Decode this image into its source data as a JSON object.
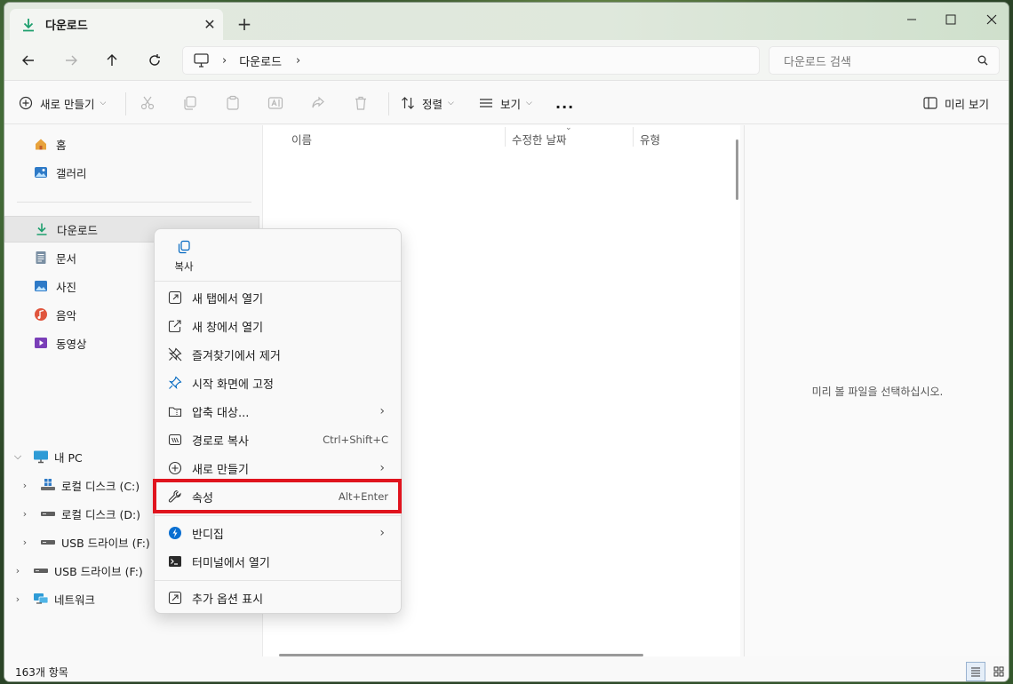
{
  "tab": {
    "title": "다운로드",
    "close_icon": "close-icon",
    "new_tab": "+"
  },
  "address": {
    "crumbs": [
      "다운로드"
    ]
  },
  "search": {
    "placeholder": "다운로드 검색"
  },
  "toolbar": {
    "new_label": "새로 만들기",
    "sort_label": "정렬",
    "view_label": "보기",
    "more_label": "...",
    "preview_label": "미리 보기"
  },
  "sidebar": {
    "top_items": [
      {
        "label": "홈",
        "icon": "home-icon"
      },
      {
        "label": "갤러리",
        "icon": "gallery-icon"
      }
    ],
    "quick_items": [
      {
        "label": "다운로드",
        "icon": "download-icon"
      },
      {
        "label": "문서",
        "icon": "document-icon"
      },
      {
        "label": "사진",
        "icon": "pictures-icon"
      },
      {
        "label": "음악",
        "icon": "music-icon"
      },
      {
        "label": "동영상",
        "icon": "video-icon"
      }
    ],
    "pc_items": [
      {
        "label": "내 PC",
        "icon": "pc-icon"
      },
      {
        "label": "로컬 디스크 (C:)",
        "icon": "windows-drive-icon"
      },
      {
        "label": "로컬 디스크 (D:)",
        "icon": "drive-icon"
      },
      {
        "label": "USB 드라이브 (F:)",
        "icon": "usb-drive-icon"
      },
      {
        "label": "USB 드라이브 (F:)",
        "icon": "usb-drive-icon"
      },
      {
        "label": "네트워크",
        "icon": "network-icon"
      }
    ]
  },
  "columns": [
    "이름",
    "수정한 날짜",
    "유형"
  ],
  "preview_message": "미리 볼 파일을 선택하십시오.",
  "status": {
    "count": "163개 항목"
  },
  "context_menu": {
    "copy_label": "복사",
    "items": [
      {
        "label": "새 탭에서 열기",
        "icon": "open-new-tab-icon",
        "shortcut": "",
        "arrow": ""
      },
      {
        "label": "새 창에서 열기",
        "icon": "open-new-window-icon",
        "shortcut": "",
        "arrow": ""
      },
      {
        "label": "즐겨찾기에서 제거",
        "icon": "unpin-icon",
        "shortcut": "",
        "arrow": ""
      },
      {
        "label": "시작 화면에 고정",
        "icon": "pin-icon",
        "shortcut": "",
        "arrow": ""
      },
      {
        "label": "압축 대상...",
        "icon": "zip-icon",
        "shortcut": "",
        "arrow": "›"
      },
      {
        "label": "경로로 복사",
        "icon": "copy-path-icon",
        "shortcut": "Ctrl+Shift+C",
        "arrow": ""
      },
      {
        "label": "새로 만들기",
        "icon": "new-icon",
        "shortcut": "",
        "arrow": "›"
      },
      {
        "label": "속성",
        "icon": "wrench-icon",
        "shortcut": "Alt+Enter",
        "arrow": ""
      },
      {
        "label": "반디집",
        "icon": "bandizip-icon",
        "shortcut": "",
        "arrow": "›"
      },
      {
        "label": "터미널에서 열기",
        "icon": "terminal-icon",
        "shortcut": "",
        "arrow": ""
      },
      {
        "label": "추가 옵션 표시",
        "icon": "more-options-icon",
        "shortcut": "",
        "arrow": ""
      }
    ]
  },
  "colors": {
    "highlight": "#e0141e",
    "accent": "#0067c0",
    "download_green": "#1e9f6e"
  }
}
